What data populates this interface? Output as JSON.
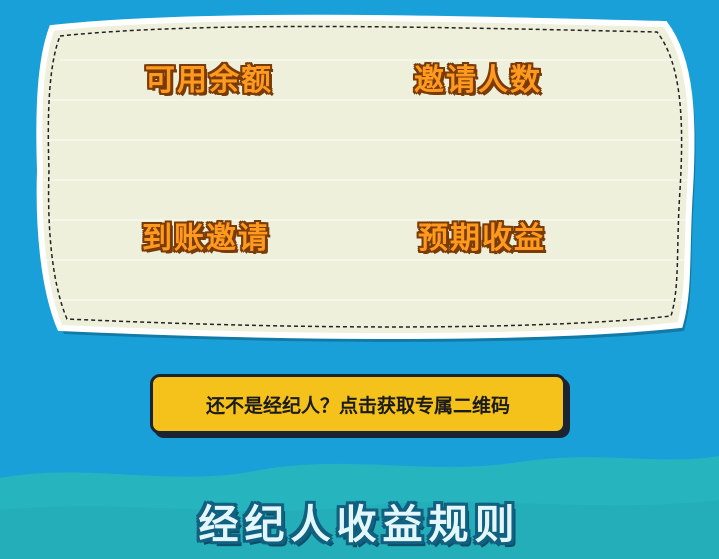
{
  "stats_card": {
    "available_balance_label": "可用余额",
    "invite_count_label": "邀请人数",
    "account_invite_label": "到账邀请",
    "expected_income_label": "预期收益"
  },
  "cta": {
    "label": "还不是经纪人？点击获取专属二维码"
  },
  "rules_section": {
    "title": "经纪人收益规则"
  },
  "colors": {
    "background": "#1aa0d8",
    "card": "#eef0dc",
    "label_orange": "#ff9a1f",
    "button_yellow": "#f5c21b",
    "wave_teal": "#26b5bf"
  }
}
